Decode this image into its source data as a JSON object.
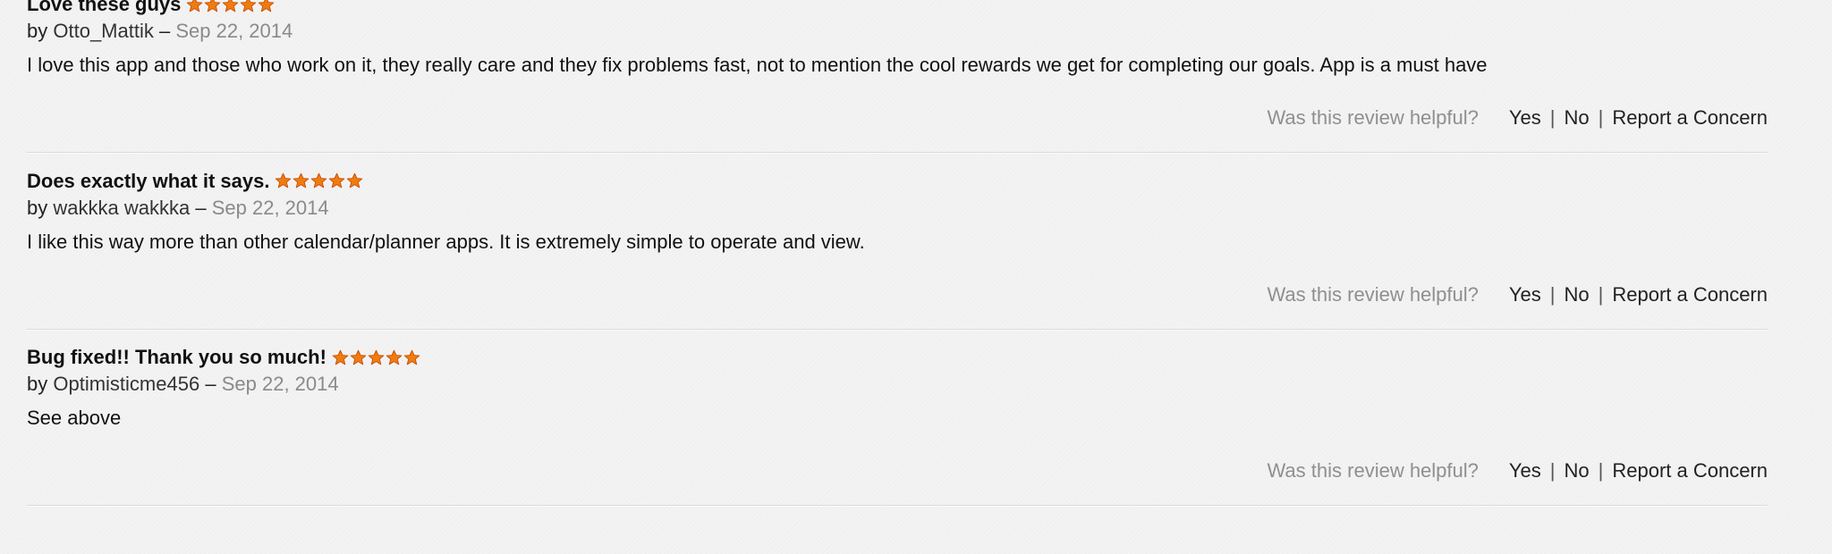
{
  "theme": {
    "star_color": "#f07c10",
    "star_edge": "#c8500a"
  },
  "reviews": [
    {
      "title": "Love these guys",
      "rating": 5,
      "by_prefix": "by",
      "author": "Otto_Mattik",
      "dash": "–",
      "date": "Sep 22, 2014",
      "body": "I love this app and those who work on it, they really care and they fix problems fast, not to mention the cool rewards we get for completing our goals. App is a must have",
      "helpful_prompt": "Was this review helpful?",
      "yes_label": "Yes",
      "no_label": "No",
      "report_label": "Report a Concern",
      "separator": "|"
    },
    {
      "title": "Does exactly what it says.",
      "rating": 5,
      "by_prefix": "by",
      "author": "wakkka wakkka",
      "dash": "–",
      "date": "Sep 22, 2014",
      "body": "I like this way more than other calendar/planner apps. It is extremely simple to operate and view.",
      "helpful_prompt": "Was this review helpful?",
      "yes_label": "Yes",
      "no_label": "No",
      "report_label": "Report a Concern",
      "separator": "|"
    },
    {
      "title": "Bug fixed!! Thank you so much!",
      "rating": 5,
      "by_prefix": "by",
      "author": "Optimisticme456",
      "dash": "–",
      "date": "Sep 22, 2014",
      "body": "See above",
      "helpful_prompt": "Was this review helpful?",
      "yes_label": "Yes",
      "no_label": "No",
      "report_label": "Report a Concern",
      "separator": "|"
    }
  ]
}
